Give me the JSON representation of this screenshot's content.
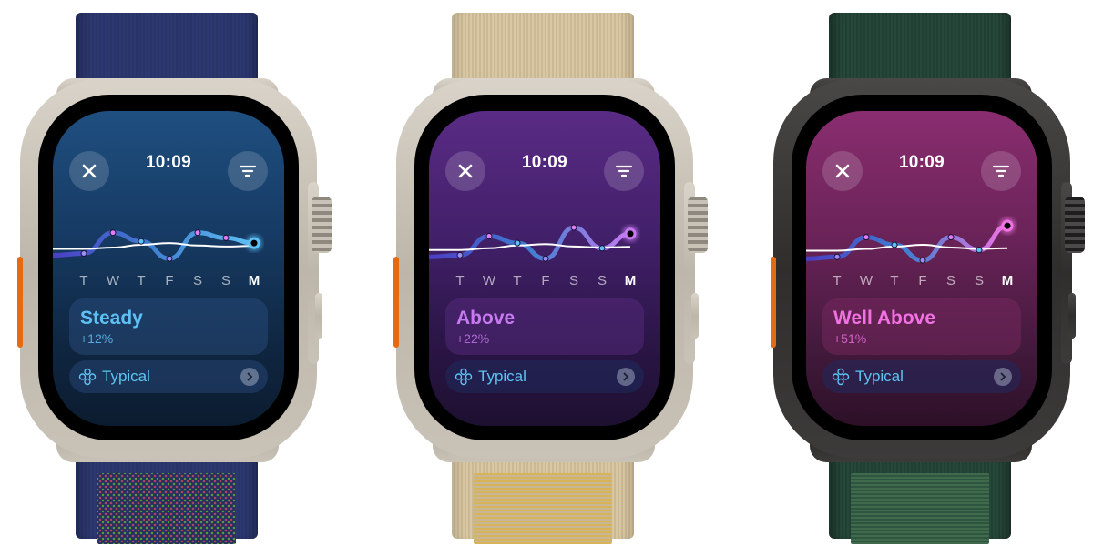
{
  "time": "10:09",
  "close_label": "Close",
  "filter_label": "Filter",
  "typical_label": "Typical",
  "days": [
    "T",
    "W",
    "T",
    "F",
    "S",
    "S",
    "M"
  ],
  "watches": [
    {
      "case": "natural titanium",
      "band": "blue",
      "theme": "blue",
      "status_label": "Steady",
      "status_pct": "+12%",
      "accent": "#5ec0f5",
      "trend": [
        0.25,
        0.85,
        0.6,
        0.1,
        0.85,
        0.7,
        0.55
      ],
      "typical": [
        0.38,
        0.42,
        0.5,
        0.55,
        0.48,
        0.45,
        0.47
      ],
      "point_colors": [
        "#9b8cff",
        "#e17cf2",
        "#5ec0f5",
        "#9b8cff",
        "#e17cf2",
        "#e17cf2",
        "#5ec0f5"
      ]
    },
    {
      "case": "natural titanium",
      "band": "tan",
      "theme": "purple",
      "status_label": "Above",
      "status_pct": "+22%",
      "accent": "#c77af0",
      "trend": [
        0.2,
        0.75,
        0.55,
        0.1,
        1.0,
        0.4,
        0.82
      ],
      "typical": [
        0.35,
        0.4,
        0.48,
        0.52,
        0.45,
        0.42,
        0.44
      ],
      "point_colors": [
        "#9b8cff",
        "#e17cf2",
        "#5ec0f5",
        "#9b8cff",
        "#e17cf2",
        "#5ec0f5",
        "#c77af0"
      ]
    },
    {
      "case": "black titanium",
      "band": "green",
      "theme": "magenta",
      "status_label": "Well Above",
      "status_pct": "+51%",
      "accent": "#f272e4",
      "trend": [
        0.15,
        0.72,
        0.5,
        0.05,
        0.72,
        0.35,
        1.05
      ],
      "typical": [
        0.33,
        0.38,
        0.45,
        0.5,
        0.42,
        0.38,
        0.4
      ],
      "point_colors": [
        "#9b8cff",
        "#e17cf2",
        "#5ec0f5",
        "#9b8cff",
        "#e17cf2",
        "#5ec0f5",
        "#f272e4"
      ]
    }
  ]
}
